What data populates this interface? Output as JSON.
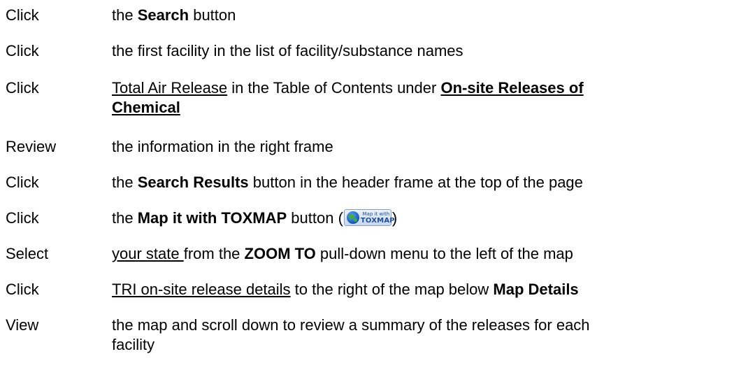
{
  "steps": [
    {
      "verb": "Click",
      "pre": "the ",
      "bold": "Search",
      "post": " button"
    },
    {
      "verb": "Click",
      "text": "the first facility in the list of facility/substance names"
    },
    {
      "verb": "Click",
      "link": "Total Air Release",
      "mid": " in the Table of Contents under ",
      "bold_link_1": "On-site Releases of",
      "bold_link_2": "Chemical"
    },
    {
      "verb": "Review",
      "text": "the information in the right frame"
    },
    {
      "verb": "Click",
      "pre": "the ",
      "bold": "Search Results",
      "post": " button in the header frame at the top of the page"
    },
    {
      "verb": "Click",
      "pre": "the ",
      "bold": "Map it with TOXMAP",
      "post": " button (",
      "close": ")",
      "button": {
        "line1": "Map it with",
        "line2": "TOXMAP",
        "icon": "globe-icon"
      }
    },
    {
      "verb": "Select",
      "link": "your state ",
      "mid": "from the ",
      "bold": "ZOOM TO",
      "post": " pull-down menu to the left of the map"
    },
    {
      "verb": "Click",
      "link": "TRI on-site release details",
      "mid": " to the right of the map below ",
      "bold": "Map Details"
    },
    {
      "verb": "View",
      "line1": "the map and scroll down to review a summary of the releases for each",
      "line2": "facility"
    }
  ]
}
